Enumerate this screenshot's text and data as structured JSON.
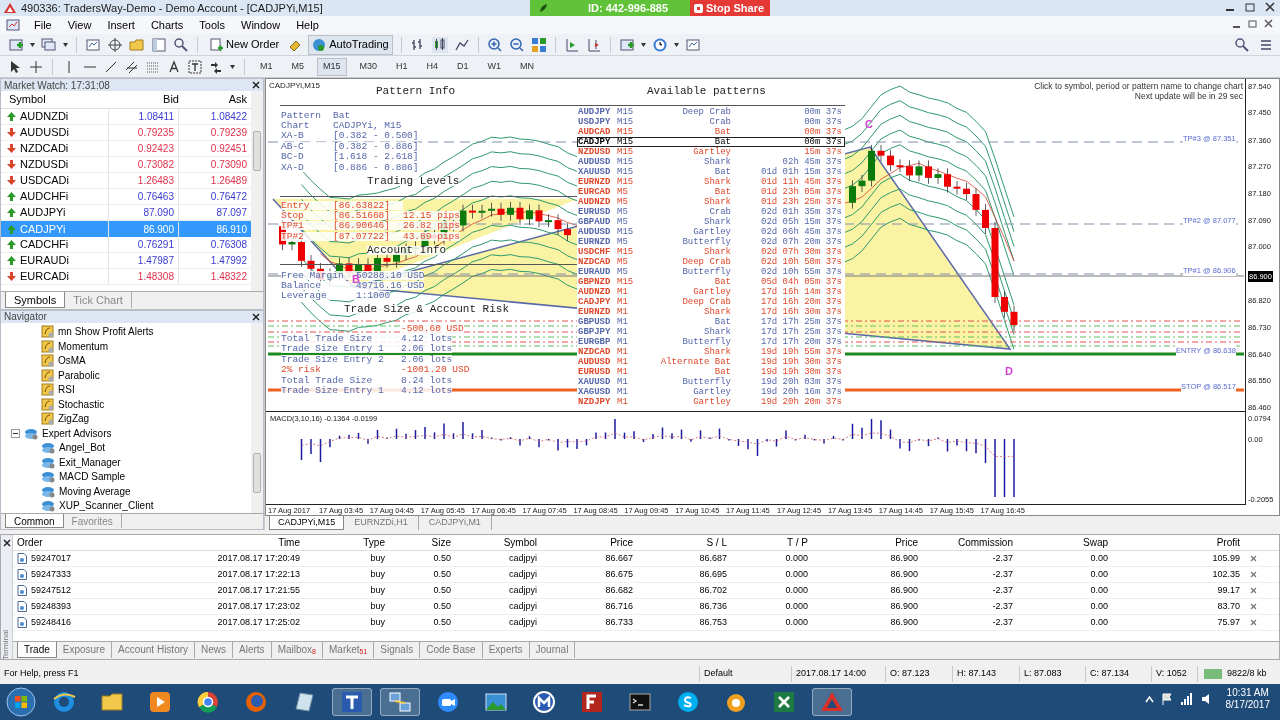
{
  "window": {
    "title": "490336: TradersWay-Demo - Demo Account - [CADJPYi,M15]"
  },
  "share_bar": {
    "id": "ID: 442-996-885",
    "stop_button": "Stop Share"
  },
  "menu": [
    "File",
    "View",
    "Insert",
    "Charts",
    "Tools",
    "Window",
    "Help"
  ],
  "toolbar": {
    "new_order": "New Order",
    "auto_trading": "AutoTrading"
  },
  "timeframes": [
    {
      "label": "M1",
      "selected": false
    },
    {
      "label": "M5",
      "selected": false
    },
    {
      "label": "M15",
      "selected": true
    },
    {
      "label": "M30",
      "selected": false
    },
    {
      "label": "H1",
      "selected": false
    },
    {
      "label": "H4",
      "selected": false
    },
    {
      "label": "D1",
      "selected": false
    },
    {
      "label": "W1",
      "selected": false
    },
    {
      "label": "MN",
      "selected": false
    }
  ],
  "market_watch": {
    "title": "Market Watch: 17:31:08",
    "columns": [
      "Symbol",
      "Bid",
      "Ask"
    ],
    "rows": [
      {
        "symbol": "AUDNZDi",
        "bid": "1.08411",
        "ask": "1.08422",
        "rising": true,
        "selected": false
      },
      {
        "symbol": "AUDUSDi",
        "bid": "0.79235",
        "ask": "0.79239",
        "rising": false,
        "selected": false
      },
      {
        "symbol": "NZDCADi",
        "bid": "0.92423",
        "ask": "0.92451",
        "rising": false,
        "selected": false
      },
      {
        "symbol": "NZDUSDi",
        "bid": "0.73082",
        "ask": "0.73090",
        "rising": false,
        "selected": false
      },
      {
        "symbol": "USDCADi",
        "bid": "1.26483",
        "ask": "1.26489",
        "rising": false,
        "selected": false
      },
      {
        "symbol": "AUDCHFi",
        "bid": "0.76463",
        "ask": "0.76472",
        "rising": true,
        "selected": false
      },
      {
        "symbol": "AUDJPYi",
        "bid": "87.090",
        "ask": "87.097",
        "rising": true,
        "selected": false
      },
      {
        "symbol": "CADJPYi",
        "bid": "86.900",
        "ask": "86.910",
        "rising": true,
        "selected": true
      },
      {
        "symbol": "CADCHFi",
        "bid": "0.76291",
        "ask": "0.76308",
        "rising": true,
        "selected": false
      },
      {
        "symbol": "EURAUDi",
        "bid": "1.47987",
        "ask": "1.47992",
        "rising": true,
        "selected": false
      },
      {
        "symbol": "EURCADi",
        "bid": "1.48308",
        "ask": "1.48322",
        "rising": false,
        "selected": false
      }
    ],
    "tabs": [
      {
        "label": "Symbols",
        "selected": true
      },
      {
        "label": "Tick Chart",
        "selected": false
      }
    ]
  },
  "navigator": {
    "title": "Navigator",
    "items": [
      {
        "label": "mn Show Profit Alerts",
        "kind": "indicator"
      },
      {
        "label": "Momentum",
        "kind": "indicator"
      },
      {
        "label": "OsMA",
        "kind": "indicator"
      },
      {
        "label": "Parabolic",
        "kind": "indicator"
      },
      {
        "label": "RSI",
        "kind": "indicator"
      },
      {
        "label": "Stochastic",
        "kind": "indicator"
      },
      {
        "label": "ZigZag",
        "kind": "indicator"
      },
      {
        "label": "Expert Advisors",
        "kind": "folder",
        "expanded": true,
        "children": [
          {
            "label": "Angel_Bot",
            "kind": "expert"
          },
          {
            "label": "Exit_Manager",
            "kind": "expert"
          },
          {
            "label": "MACD Sample",
            "kind": "expert"
          },
          {
            "label": "Moving Average",
            "kind": "expert"
          },
          {
            "label": "XUP_Scanner_Client",
            "kind": "expert"
          }
        ]
      }
    ],
    "tabs": [
      {
        "label": "Common",
        "selected": true
      },
      {
        "label": "Favorites",
        "selected": false
      }
    ]
  },
  "chart": {
    "title": "CADJPYi,M15",
    "pattern_info": {
      "title": "Pattern Info",
      "rows": [
        [
          "Pattern",
          "Bat"
        ],
        [
          "Chart",
          "CADJPYi, M15"
        ],
        [
          "XA-B",
          "[0.382 - 0.500]"
        ],
        [
          "AB-C",
          "[0.382 - 0.886]"
        ],
        [
          "BC-D",
          "[1.618 - 2.618]"
        ],
        [
          "XA-D",
          "[0.886 - 0.886]"
        ]
      ]
    },
    "trading_levels": {
      "title": "Trading Levels",
      "rows": [
        [
          "Entry",
          "[86.63822]",
          ""
        ],
        [
          "Stop",
          "[86.51668]",
          "12.15 pips"
        ],
        [
          "TP#1",
          "[86.90646]",
          "26.82 pips"
        ],
        [
          "TP#2",
          "[87.07722]",
          "43.89 pips"
        ]
      ]
    },
    "account_info": {
      "title": "Account Info",
      "rows": [
        [
          "Free Margin",
          "50288.10 USD"
        ],
        [
          "Balance",
          "49716.16 USD"
        ],
        [
          "Leverage",
          "1:1000"
        ]
      ]
    },
    "risk": {
      "title": "Trade Size & Account Risk",
      "rows": [
        [
          "",
          "-500.60 USD"
        ],
        [
          "Total Trade Size",
          "4.12 lots"
        ],
        [
          "Trade Size Entry 1",
          "2.06 lots"
        ],
        [
          "Trade Size Entry 2",
          "2.06 lots"
        ],
        [
          "2% risk",
          "-1001.20 USD"
        ],
        [
          "Total Trade Size",
          "8.24 lots"
        ],
        [
          "Trade Size Entry 1",
          "4.12 lots"
        ]
      ]
    },
    "patterns_title": "Available patterns",
    "patterns": [
      {
        "symbol": "AUDJPY",
        "period": "M15",
        "pattern": "Deep Crab",
        "age": "00m 37s",
        "color": "#5566aa",
        "selected": false
      },
      {
        "symbol": "USDJPY",
        "period": "M15",
        "pattern": "Crab",
        "age": "00m 37s",
        "color": "#5566aa",
        "selected": false
      },
      {
        "symbol": "AUDCAD",
        "period": "M15",
        "pattern": "Bat",
        "age": "00m 37s",
        "color": "#e0482a",
        "selected": false
      },
      {
        "symbol": "CADJPY",
        "period": "M15",
        "pattern": "Bat",
        "age": "00m 37s",
        "color": "#000000",
        "selected": true
      },
      {
        "symbol": "NZDUSD",
        "period": "M15",
        "pattern": "Gartley",
        "age": "15m 37s",
        "color": "#e0482a",
        "selected": false
      },
      {
        "symbol": "AUDUSD",
        "period": "M15",
        "pattern": "Shark",
        "age": "02h 45m 37s",
        "color": "#5566aa",
        "selected": false
      },
      {
        "symbol": "XAUUSD",
        "period": "M15",
        "pattern": "Bat",
        "age": "01d 01h 15m 37s",
        "color": "#5566aa",
        "selected": false
      },
      {
        "symbol": "EURNZD",
        "period": "M15",
        "pattern": "Shark",
        "age": "01d 11h 45m 37s",
        "color": "#e0482a",
        "selected": false
      },
      {
        "symbol": "EURCAD",
        "period": "M5",
        "pattern": "Bat",
        "age": "01d 23h 05m 37s",
        "color": "#e0482a",
        "selected": false
      },
      {
        "symbol": "AUDNZD",
        "period": "M5",
        "pattern": "Shark",
        "age": "01d 23h 25m 37s",
        "color": "#e0482a",
        "selected": false
      },
      {
        "symbol": "EURUSD",
        "period": "M5",
        "pattern": "Crab",
        "age": "02d 01h 35m 37s",
        "color": "#5566aa",
        "selected": false
      },
      {
        "symbol": "GBPAUD",
        "period": "M5",
        "pattern": "Shark",
        "age": "02d 05h 15m 37s",
        "color": "#5566aa",
        "selected": false
      },
      {
        "symbol": "AUDUSD",
        "period": "M15",
        "pattern": "Gartley",
        "age": "02d 06h 45m 37s",
        "color": "#5566aa",
        "selected": false
      },
      {
        "symbol": "EURNZD",
        "period": "M5",
        "pattern": "Butterfly",
        "age": "02d 07h 20m 37s",
        "color": "#5566aa",
        "selected": false
      },
      {
        "symbol": "USDCHF",
        "period": "M15",
        "pattern": "Shark",
        "age": "02d 07h 30m 37s",
        "color": "#e0482a",
        "selected": false
      },
      {
        "symbol": "NZDCAD",
        "period": "M5",
        "pattern": "Deep Crab",
        "age": "02d 10h 50m 37s",
        "color": "#e0482a",
        "selected": false
      },
      {
        "symbol": "EURAUD",
        "period": "M5",
        "pattern": "Butterfly",
        "age": "02d 10h 55m 37s",
        "color": "#5566aa",
        "selected": false
      },
      {
        "symbol": "GBPNZD",
        "period": "M15",
        "pattern": "Bat",
        "age": "05d 04h 05m 37s",
        "color": "#e0482a",
        "selected": false
      },
      {
        "symbol": "AUDNZD",
        "period": "M1",
        "pattern": "Gartley",
        "age": "17d 16h 14m 37s",
        "color": "#e0482a",
        "selected": false
      },
      {
        "symbol": "CADJPY",
        "period": "M1",
        "pattern": "Deep Crab",
        "age": "17d 16h 20m 37s",
        "color": "#e0482a",
        "selected": false
      },
      {
        "symbol": "EURNZD",
        "period": "M1",
        "pattern": "Shark",
        "age": "17d 16h 30m 37s",
        "color": "#e0482a",
        "selected": false
      },
      {
        "symbol": "GBPUSD",
        "period": "M1",
        "pattern": "Bat",
        "age": "17d 17h 25m 37s",
        "color": "#5566aa",
        "selected": false
      },
      {
        "symbol": "GBPJPY",
        "period": "M1",
        "pattern": "Shark",
        "age": "17d 17h 25m 37s",
        "color": "#5566aa",
        "selected": false
      },
      {
        "symbol": "EURGBP",
        "period": "M1",
        "pattern": "Butterfly",
        "age": "17d 17h 20m 37s",
        "color": "#5566aa",
        "selected": false
      },
      {
        "symbol": "NZDCAD",
        "period": "M1",
        "pattern": "Shark",
        "age": "19d 19h 55m 37s",
        "color": "#e0482a",
        "selected": false
      },
      {
        "symbol": "AUDUSD",
        "period": "M1",
        "pattern": "Alternate Bat",
        "age": "19d 19h 30m 37s",
        "color": "#e0482a",
        "selected": false
      },
      {
        "symbol": "EURUSD",
        "period": "M1",
        "pattern": "Bat",
        "age": "19d 19h 30m 37s",
        "color": "#e0482a",
        "selected": false
      },
      {
        "symbol": "XAUUSD",
        "period": "M1",
        "pattern": "Butterfly",
        "age": "19d 20h 03m 37s",
        "color": "#5566aa",
        "selected": false
      },
      {
        "symbol": "XAGUSD",
        "period": "M1",
        "pattern": "Gartley",
        "age": "19d 20h 16m 37s",
        "color": "#5566aa",
        "selected": false
      },
      {
        "symbol": "NZDJPY",
        "period": "M1",
        "pattern": "Gartley",
        "age": "19d 20h 20m 37s",
        "color": "#e0482a",
        "selected": false
      }
    ],
    "hint": [
      "Click to symbol, period or pattern name to change chart",
      "Next update will be in 29 sec"
    ],
    "levels": [
      {
        "label": "TP#3 @ 87.351",
        "kind": "target"
      },
      {
        "label": "TP#2 @ 87.077",
        "kind": "target"
      },
      {
        "label": "TP#1 @ 86.906",
        "kind": "target"
      },
      {
        "label": "ENTRY @ 86.638",
        "kind": "entry"
      },
      {
        "label": "STOP @ 86.517",
        "kind": "stop"
      }
    ],
    "points": [
      "B",
      "C",
      "D"
    ],
    "price_axis": [
      {
        "label": "87.540",
        "current": false
      },
      {
        "label": "87.450",
        "current": false
      },
      {
        "label": "87.360",
        "current": false
      },
      {
        "label": "87.270",
        "current": false
      },
      {
        "label": "87.180",
        "current": false
      },
      {
        "label": "87.090",
        "current": false
      },
      {
        "label": "87.000",
        "current": false
      },
      {
        "label": "86.900",
        "current": true
      },
      {
        "label": "86.820",
        "current": false
      },
      {
        "label": "86.730",
        "current": false
      },
      {
        "label": "86.640",
        "current": false
      },
      {
        "label": "86.550",
        "current": false
      },
      {
        "label": "86.460",
        "current": false
      }
    ],
    "macd": {
      "label": "MACD(3,10,16) -0.1364 -0.0199",
      "axis": [
        "0.0794",
        "0.00",
        "-0.2055"
      ]
    },
    "time_axis": [
      "17 Aug 2017",
      "17 Aug 03:45",
      "17 Aug 04:45",
      "17 Aug 05:45",
      "17 Aug 06:45",
      "17 Aug 07:45",
      "17 Aug 08:45",
      "17 Aug 09:45",
      "17 Aug 10:45",
      "17 Aug 11:45",
      "17 Aug 12:45",
      "17 Aug 13:45",
      "17 Aug 14:45",
      "17 Aug 15:45",
      "17 Aug 16:45"
    ]
  },
  "chart_tabs": [
    {
      "label": "CADJPYi,M15",
      "selected": true
    },
    {
      "label": "EURNZDi,H1",
      "selected": false
    },
    {
      "label": "CADJPYi,M1",
      "selected": false
    }
  ],
  "terminal": {
    "label": "Terminal",
    "columns": [
      "Order",
      "Time",
      "Type",
      "Size",
      "Symbol",
      "Price",
      "S / L",
      "T / P",
      "Price",
      "Commission",
      "Swap",
      "Profit"
    ],
    "rows": [
      [
        "59247017",
        "2017.08.17 17:20:49",
        "buy",
        "0.50",
        "cadjpyi",
        "86.667",
        "86.687",
        "0.000",
        "86.900",
        "-2.37",
        "0.00",
        "105.99"
      ],
      [
        "59247333",
        "2017.08.17 17:22:13",
        "buy",
        "0.50",
        "cadjpyi",
        "86.675",
        "86.695",
        "0.000",
        "86.900",
        "-2.37",
        "0.00",
        "102.35"
      ],
      [
        "59247512",
        "2017.08.17 17:21:55",
        "buy",
        "0.50",
        "cadjpyi",
        "86.682",
        "86.702",
        "0.000",
        "86.900",
        "-2.37",
        "0.00",
        "99.17"
      ],
      [
        "59248393",
        "2017.08.17 17:23:02",
        "buy",
        "0.50",
        "cadjpyi",
        "86.716",
        "86.736",
        "0.000",
        "86.900",
        "-2.37",
        "0.00",
        "83.70"
      ],
      [
        "59248416",
        "2017.08.17 17:25:02",
        "buy",
        "0.50",
        "cadjpyi",
        "86.733",
        "86.753",
        "0.000",
        "86.900",
        "-2.37",
        "0.00",
        "75.97"
      ]
    ],
    "tabs": [
      {
        "label": "Trade",
        "selected": true
      },
      {
        "label": "Exposure",
        "selected": false
      },
      {
        "label": "Account History",
        "selected": false
      },
      {
        "label": "News",
        "selected": false
      },
      {
        "label": "Alerts",
        "selected": false
      },
      {
        "label": "Mailbox",
        "badge": "8",
        "selected": false
      },
      {
        "label": "Market",
        "badge": "51",
        "selected": false
      },
      {
        "label": "Signals",
        "selected": false
      },
      {
        "label": "Code Base",
        "selected": false
      },
      {
        "label": "Experts",
        "selected": false
      },
      {
        "label": "Journal",
        "selected": false
      }
    ]
  },
  "status_bar": {
    "help": "For Help, press F1",
    "profile": "Default",
    "datetime": "2017.08.17 14:00",
    "open": "O: 87.123",
    "high": "H: 87.143",
    "low": "L: 87.083",
    "close": "C: 87.134",
    "volume": "V: 1052",
    "traffic": "9822/8 kb"
  },
  "taskbar": {
    "time": "10:31 AM",
    "date": "8/17/2017"
  }
}
